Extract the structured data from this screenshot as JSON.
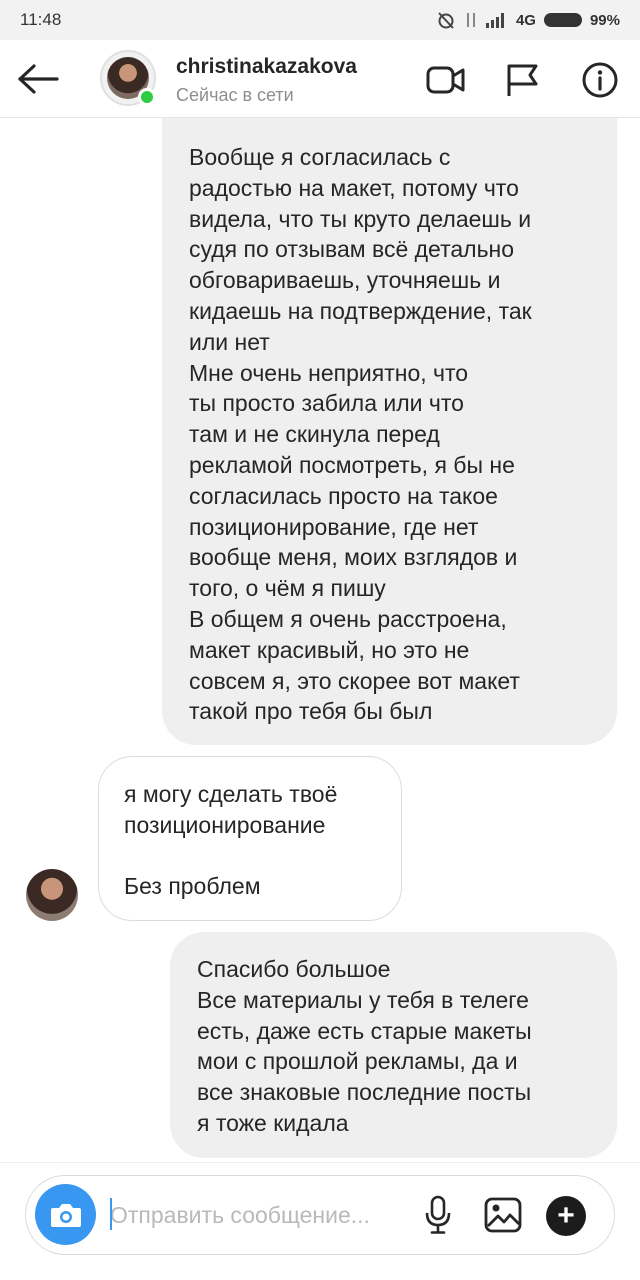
{
  "status_bar": {
    "time": "11:48",
    "network": "4G",
    "battery": "99%"
  },
  "header": {
    "username": "christinakazakova",
    "status": "Сейчас в сети",
    "icons": [
      "back-arrow-icon",
      "avatar",
      "video-call-icon",
      "flag-icon",
      "info-icon"
    ]
  },
  "messages": [
    {
      "direction": "outgoing",
      "text": "Вообще я согласилась с\nрадостью на макет, потому что\nвидела, что ты круто делаешь и\nсудя по отзывам всё детально\nобговариваешь, уточняешь и\nкидаешь на подтверждение, так\nили нет\nМне очень неприятно, что\nты просто забила или что\nтам и не скинула перед\nрекламой посмотреть, я бы не\nсогласилась просто на такое\nпозиционирование, где нет\nвообще меня, моих взглядов и\nтого, о чём я пишу\nВ общем я очень расстроена,\nмакет красивый, но это не\nсовсем я, это скорее вот макет\nтакой про тебя бы был"
    },
    {
      "direction": "incoming",
      "text": "я могу сделать твоё\nпозиционирование\n\nБез проблем"
    },
    {
      "direction": "outgoing",
      "text": "Спасибо большое\nВсе материалы у тебя в телеге\nесть, даже есть старые макеты\nмои с прошлой рекламы, да и\nвсе знаковые последние посты\nя тоже кидала"
    }
  ],
  "composer": {
    "placeholder": "Отправить сообщение...",
    "value": "",
    "plus_label": "+"
  },
  "colors": {
    "accent_blue": "#3897f0",
    "online_green": "#2ecc40",
    "outgoing_bubble": "#efefef",
    "incoming_border": "#dbdbdb"
  }
}
